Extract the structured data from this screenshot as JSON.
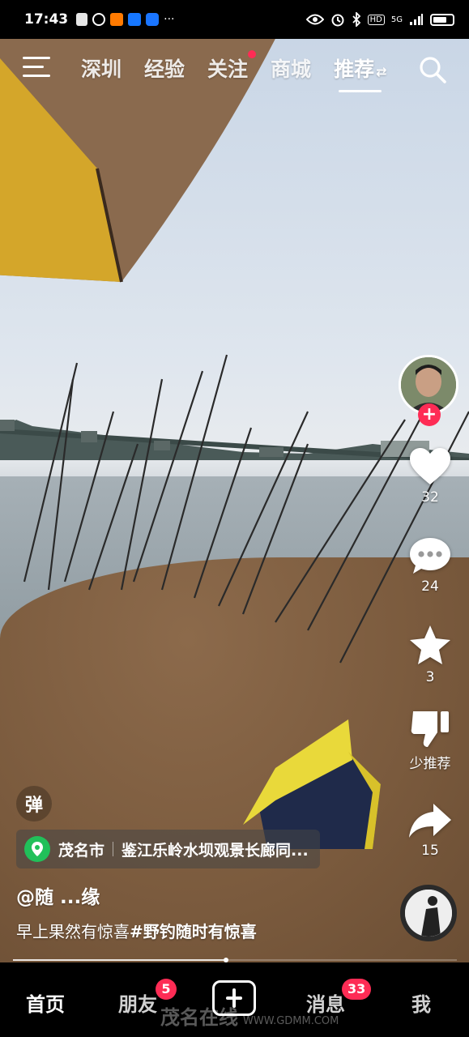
{
  "status_bar": {
    "time": "17:43",
    "network": "5G",
    "hd_label": "HD",
    "more_label": "···",
    "colors": {
      "app1": "#ff7a00",
      "app2": "#1677ff",
      "app3": "#1a75ff"
    }
  },
  "top_nav": {
    "tabs": [
      {
        "label": "深圳",
        "active": false
      },
      {
        "label": "经验",
        "active": false
      },
      {
        "label": "关注",
        "active": false,
        "dot": true
      },
      {
        "label": "商城",
        "active": false
      },
      {
        "label": "推荐",
        "active": true
      }
    ],
    "swap_glyph": "⇄"
  },
  "right_actions": {
    "like_count": "32",
    "comment_count": "24",
    "favorite_count": "3",
    "not_interested_label": "少推荐",
    "share_count": "15",
    "follow_glyph": "+"
  },
  "danmu_toggle": "弹",
  "location": {
    "city": "茂名市",
    "place": "鉴江乐岭水坝观景长廊同..."
  },
  "author": "@随 ...缘",
  "caption": {
    "text": "早上果然有惊喜",
    "hashtag": "#野钓随时有惊喜"
  },
  "progress": {
    "fraction": 0.48
  },
  "bottom_nav": {
    "home": "首页",
    "friends": "朋友",
    "friends_badge": "5",
    "messages": "消息",
    "messages_badge": "33",
    "me": "我"
  },
  "watermark": {
    "brand": "茂名在线",
    "url": "WWW.GDMM.COM"
  },
  "accent_color": "#fe2c55"
}
